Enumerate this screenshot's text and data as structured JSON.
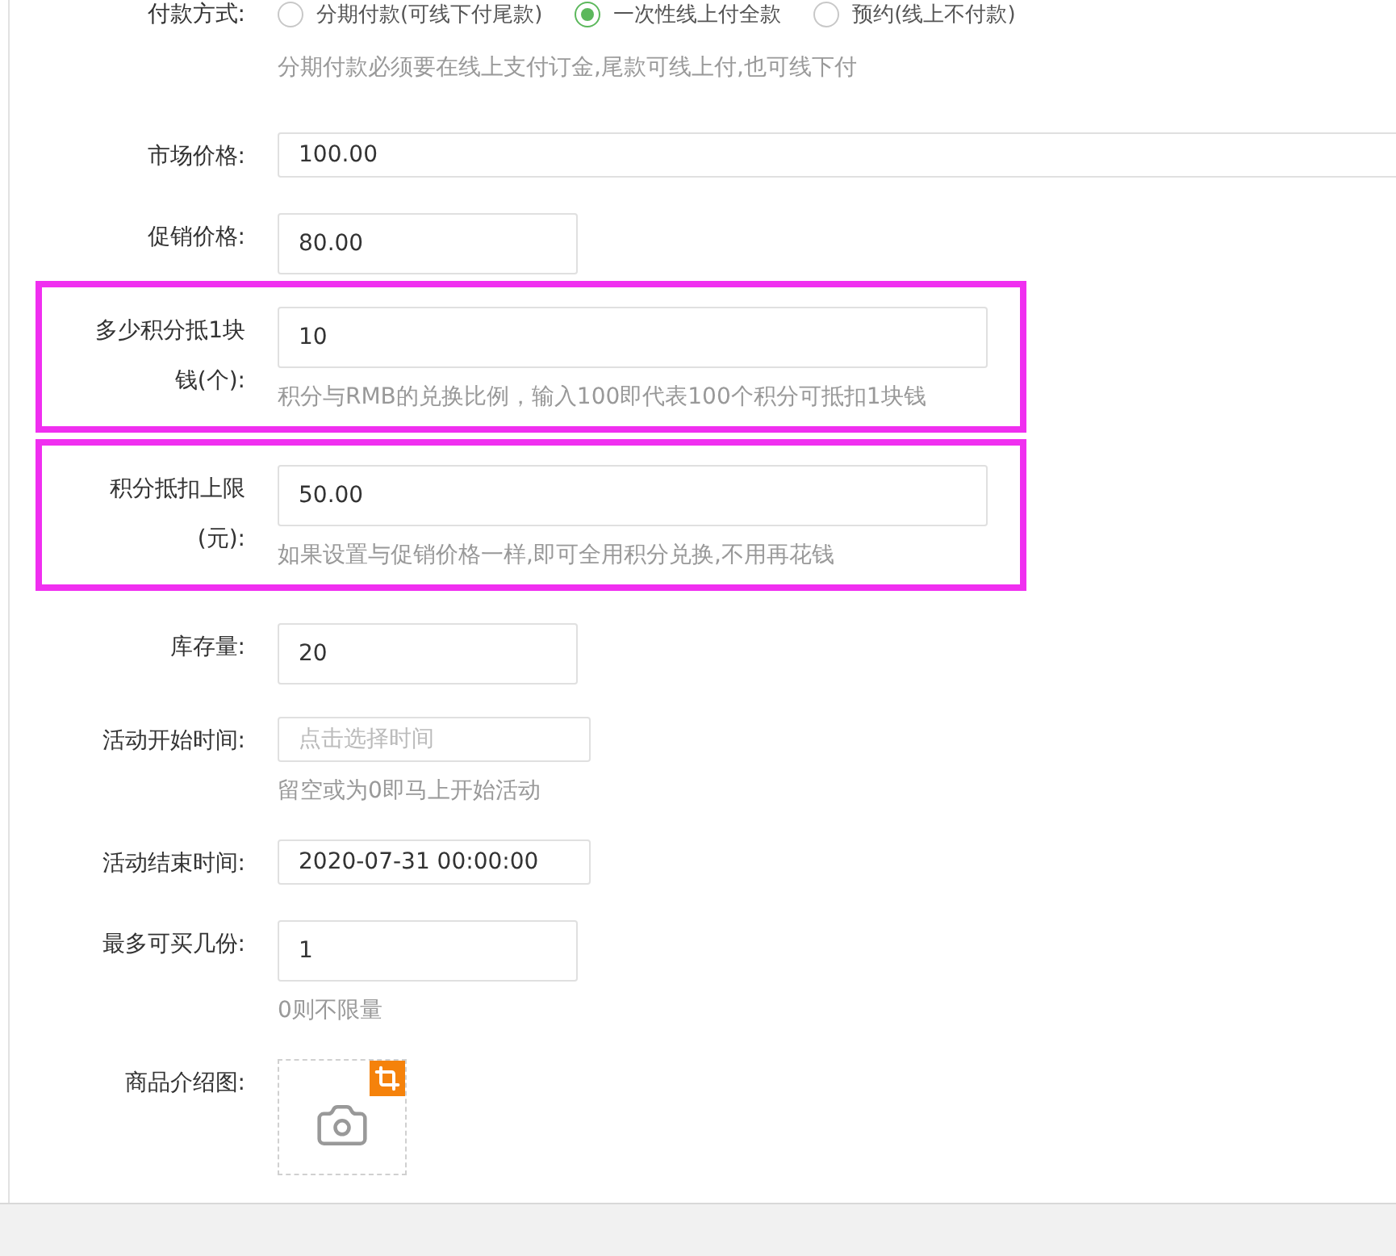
{
  "rows": [
    {
      "kind": "radio",
      "label": "付款方式:",
      "options": [
        {
          "label": "分期付款(可线下付尾款)",
          "selected": false
        },
        {
          "label": "一次性线上付全款",
          "selected": true
        },
        {
          "label": "预约(线上不付款)",
          "selected": false
        }
      ],
      "hint": "分期付款必须要在线上支付订金,尾款可线上付,也可线下付",
      "highlighted": false
    },
    {
      "kind": "wide",
      "label": "市场价格:",
      "value": "100.00",
      "highlighted": false
    },
    {
      "kind": "text",
      "label": "促销价格:",
      "value": "80.00",
      "highlighted": false
    },
    {
      "kind": "text",
      "label": "多少积分抵1块钱(个):",
      "value": "10",
      "hint": "积分与RMB的兑换比例，输入100即代表100个积分可抵扣1块钱",
      "highlighted": true
    },
    {
      "kind": "text",
      "label": "积分抵扣上限(元):",
      "value": "50.00",
      "hint": "如果设置与促销价格一样,即可全用积分兑换,不用再花钱",
      "highlighted": true
    },
    {
      "kind": "text",
      "label": "库存量:",
      "value": "20",
      "highlighted": false
    },
    {
      "kind": "time",
      "label": "活动开始时间:",
      "placeholder": "点击选择时间",
      "hint": "留空或为0即马上开始活动",
      "highlighted": false
    },
    {
      "kind": "time",
      "label": "活动结束时间:",
      "value": "2020-07-31 00:00:00",
      "highlighted": false
    },
    {
      "kind": "text",
      "label": "最多可买几份:",
      "value": "1",
      "hint": "0则不限量",
      "highlighted": false
    },
    {
      "kind": "image",
      "label": "商品介绍图:",
      "highlighted": false
    }
  ]
}
